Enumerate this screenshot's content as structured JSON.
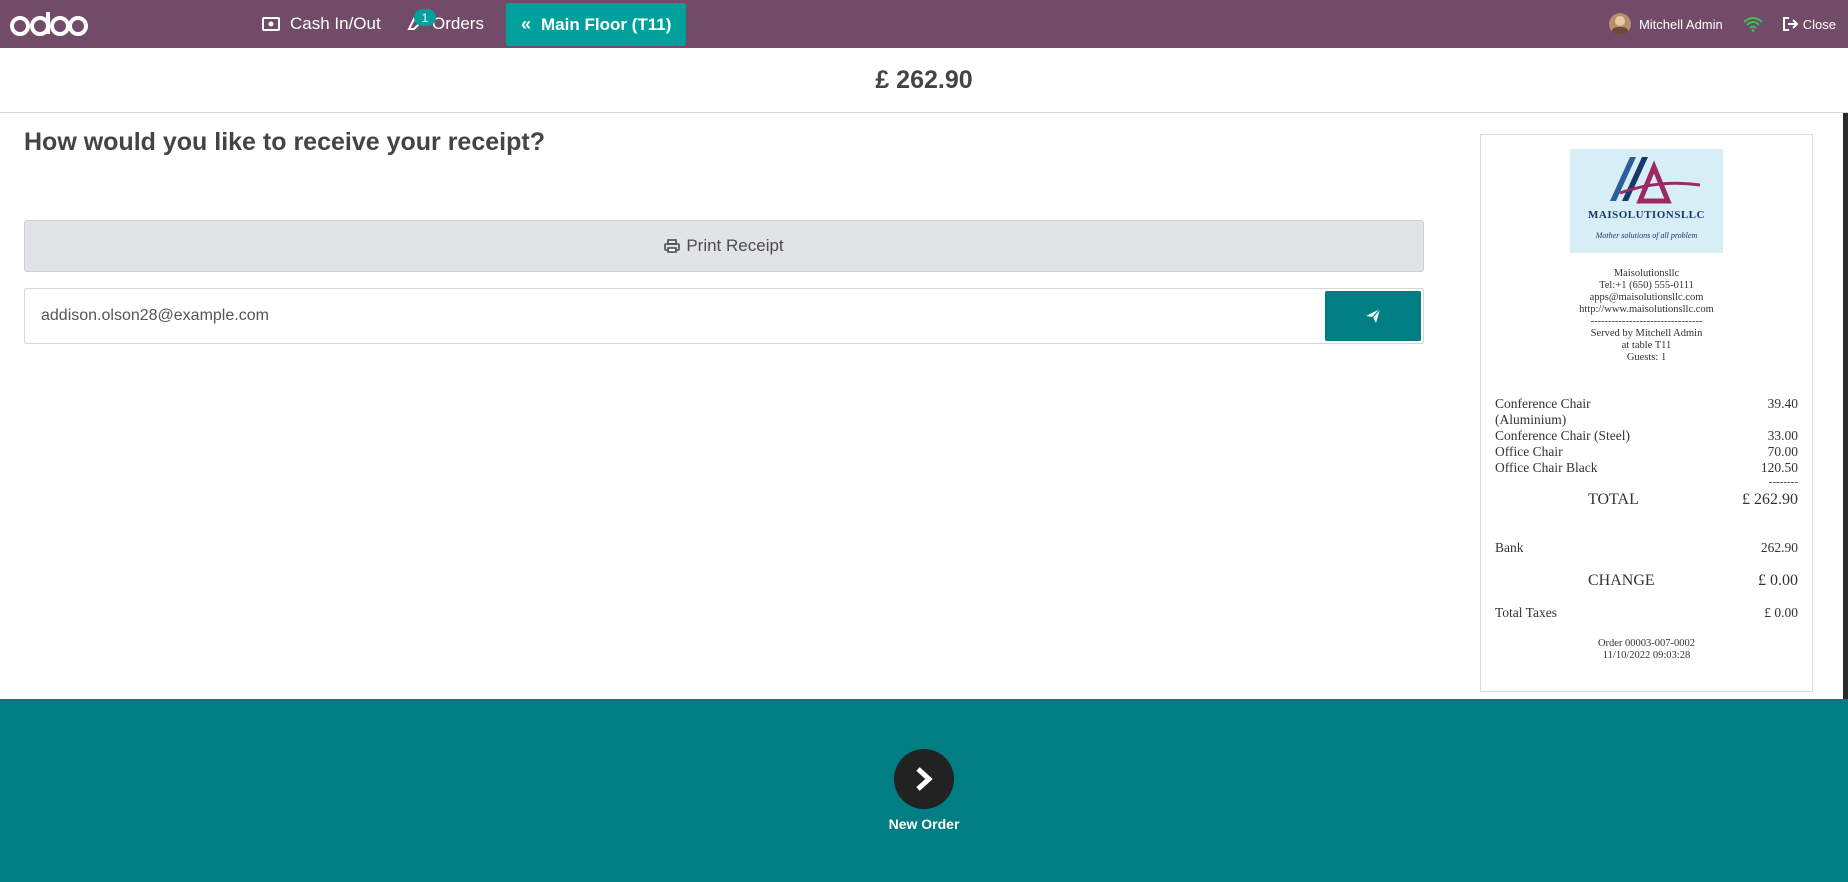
{
  "navbar": {
    "logo_text": "odoo",
    "cash_label": "Cash In/Out",
    "orders_label": "Orders",
    "orders_badge": "1",
    "floor_label": "Main Floor (T11)",
    "user_name": "Mitchell Admin",
    "close_label": "Close"
  },
  "total": {
    "amount": "£ 262.90"
  },
  "receipt_prompt": {
    "question": "How would you like to receive your receipt?",
    "print_label": "Print Receipt",
    "email_value": "addison.olson28@example.com"
  },
  "receipt": {
    "logo_title": "MAISOLUTIONSLLC",
    "logo_tagline": "Mother solutions of all problem",
    "company": "Maisolutionsllc",
    "tel": "Tel:+1 (650) 555-0111",
    "email": "apps@maisolutionsllc.com",
    "website": "http://www.maisolutionsllc.com",
    "separator": "--------------------------------",
    "served_by": "Served by Mitchell Admin",
    "table": "at table T11",
    "guests": "Guests: 1",
    "lines": [
      {
        "name": "Conference Chair (Aluminium)",
        "amount": "39.40"
      },
      {
        "name": "Conference Chair (Steel)",
        "amount": "33.00"
      },
      {
        "name": "Office Chair",
        "amount": "70.00"
      },
      {
        "name": "Office Chair Black",
        "amount": "120.50"
      }
    ],
    "subtotal_sep": "--------",
    "total_label": "TOTAL",
    "total_value": "£ 262.90",
    "payment_label": "Bank",
    "payment_value": "262.90",
    "change_label": "CHANGE",
    "change_value": "£ 0.00",
    "taxes_label": "Total Taxes",
    "taxes_value": "£ 0.00",
    "order_ref": "Order 00003-007-0002",
    "order_date": "11/10/2022 09:03:28"
  },
  "footer": {
    "new_order_label": "New Order"
  },
  "colors": {
    "navbar": "#714b67",
    "accent": "#00a09d",
    "footer": "#017e84"
  }
}
